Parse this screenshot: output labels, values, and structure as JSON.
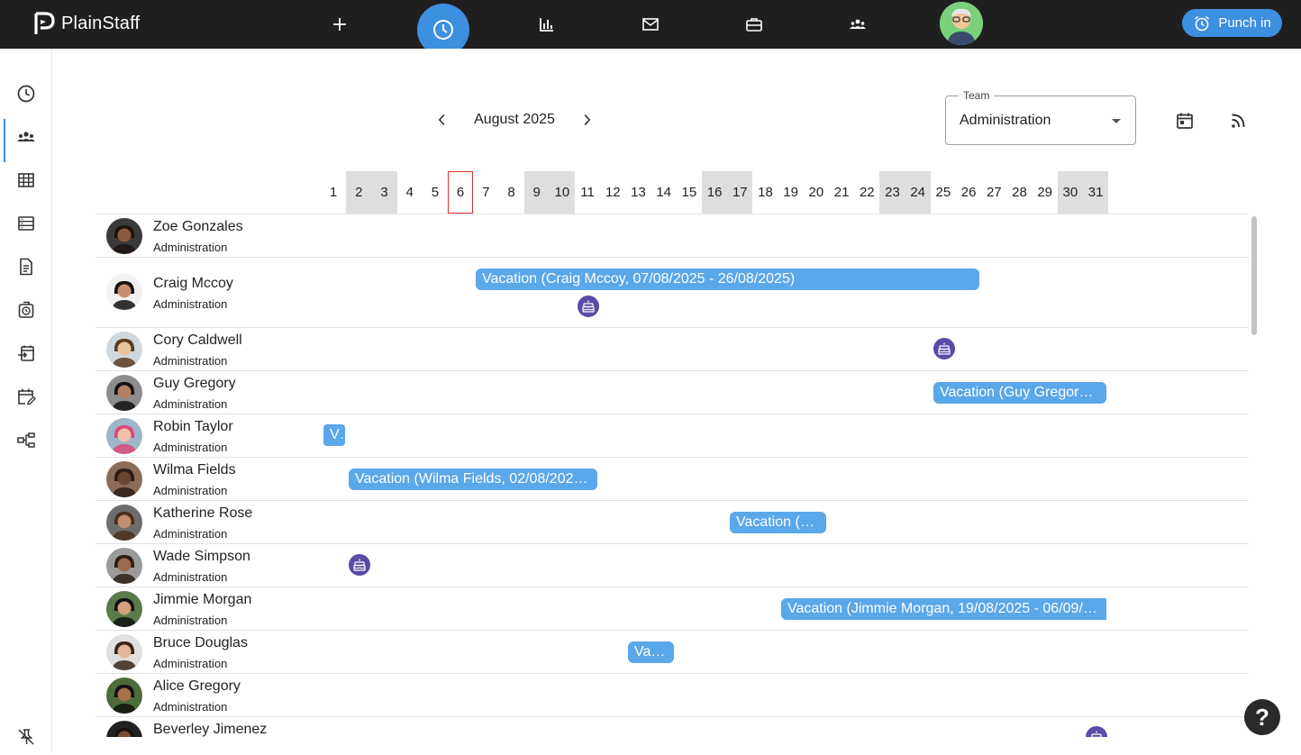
{
  "app": {
    "name": "PlainStaff"
  },
  "topbar": {
    "icons": [
      "plus-icon",
      "clock-icon",
      "bar-chart-icon",
      "mail-icon",
      "briefcase-icon",
      "team-icon"
    ],
    "punch_label": "Punch in",
    "accent": "#3d8fe0"
  },
  "sidebar": {
    "items": [
      "clock-icon",
      "team-icon",
      "grid-icon",
      "list-icon",
      "document-icon",
      "timer-icon",
      "transfer-icon",
      "calendar-edit-icon",
      "hierarchy-icon"
    ],
    "active_index": 1,
    "bottom_icon": "unpin-icon"
  },
  "calendar": {
    "month_label": "August 2025",
    "team_label": "Team",
    "team_value": "Administration",
    "today": 6,
    "weekends": [
      2,
      3,
      9,
      10,
      16,
      17,
      23,
      24,
      30,
      31
    ],
    "days": [
      "1",
      "2",
      "3",
      "4",
      "5",
      "6",
      "7",
      "8",
      "9",
      "10",
      "11",
      "12",
      "13",
      "14",
      "15",
      "16",
      "17",
      "18",
      "19",
      "20",
      "21",
      "22",
      "23",
      "24",
      "25",
      "26",
      "27",
      "28",
      "29",
      "30",
      "31"
    ]
  },
  "employees": [
    {
      "name": "Zoe Gonzales",
      "team": "Administration"
    },
    {
      "name": "Craig Mccoy",
      "team": "Administration"
    },
    {
      "name": "Cory Caldwell",
      "team": "Administration"
    },
    {
      "name": "Guy Gregory",
      "team": "Administration"
    },
    {
      "name": "Robin Taylor",
      "team": "Administration"
    },
    {
      "name": "Wilma Fields",
      "team": "Administration"
    },
    {
      "name": "Katherine Rose",
      "team": "Administration"
    },
    {
      "name": "Wade Simpson",
      "team": "Administration"
    },
    {
      "name": "Jimmie Morgan",
      "team": "Administration"
    },
    {
      "name": "Bruce Douglas",
      "team": "Administration"
    },
    {
      "name": "Alice Gregory",
      "team": "Administration"
    },
    {
      "name": "Beverley Jimenez",
      "team": ""
    }
  ],
  "events": [
    {
      "label": "Vacation (Craig Mccoy, 07/08/2025 - 26/08/2025)"
    },
    {
      "label": "Vacation (Guy Gregory…"
    },
    {
      "label": "V"
    },
    {
      "label": "Vacation (Wilma Fields, 02/08/202…"
    },
    {
      "label": "Vacation (…"
    },
    {
      "label": "Vacation (Jimmie Morgan, 19/08/2025 - 06/09/…"
    },
    {
      "label": "Va…"
    }
  ],
  "help_label": "?"
}
